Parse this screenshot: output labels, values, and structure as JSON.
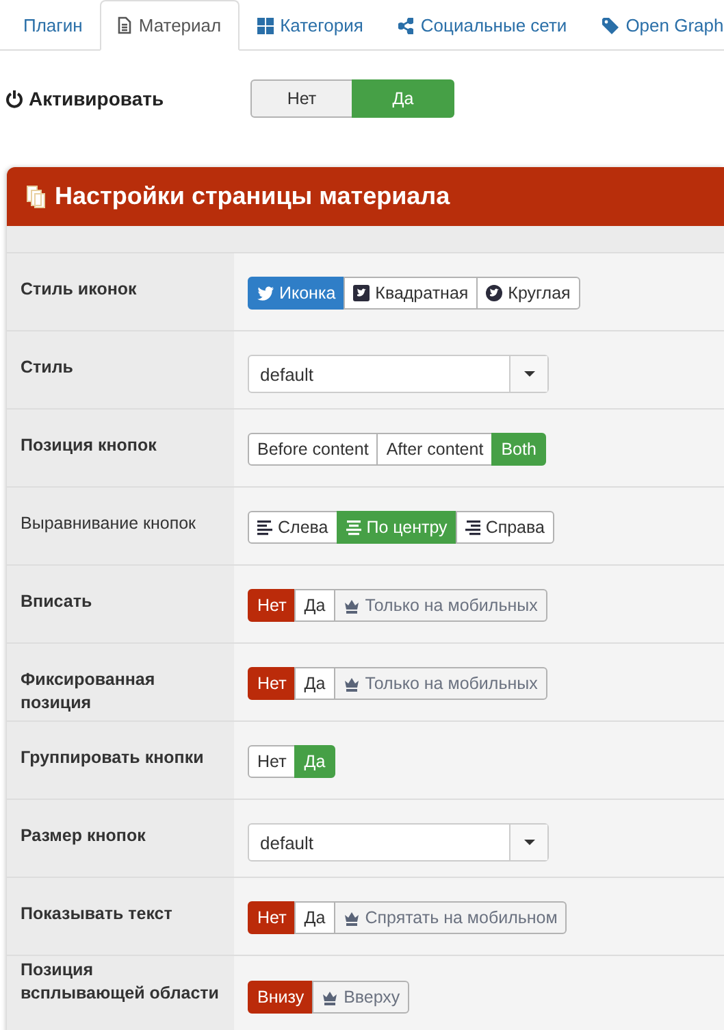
{
  "tabs": [
    {
      "label": "Плагин",
      "selected": false
    },
    {
      "label": "Материал",
      "selected": true
    },
    {
      "label": "Категория",
      "selected": false
    },
    {
      "label": "Социальные сети",
      "selected": false
    },
    {
      "label": "Open Graph",
      "selected": false
    }
  ],
  "activate": {
    "label": "Активировать",
    "options": [
      {
        "label": "Нет",
        "selected": false
      },
      {
        "label": "Да",
        "selected": true,
        "color": "#46a046"
      }
    ]
  },
  "panel": {
    "title": "Настройки страницы материала",
    "rows": [
      {
        "label": "Стиль иконок",
        "bold": true,
        "kind": "buttons",
        "options": [
          {
            "label": "Иконка",
            "selected": true,
            "color": "#2f7ec7",
            "kind": "plain"
          },
          {
            "label": "Квадратная",
            "selected": false,
            "kind": "plain"
          },
          {
            "label": "Круглая",
            "selected": false,
            "kind": "plain"
          }
        ]
      },
      {
        "label": "Стиль",
        "bold": true,
        "kind": "select",
        "value": "default"
      },
      {
        "label": "Позиция кнопок",
        "bold": true,
        "kind": "buttons",
        "options": [
          {
            "label": "Before content",
            "selected": false,
            "kind": "plain"
          },
          {
            "label": "After content",
            "selected": false,
            "kind": "plain"
          },
          {
            "label": "Both",
            "selected": true,
            "color": "#46a046",
            "kind": "plain"
          }
        ]
      },
      {
        "label": "Выравнивание кнопок",
        "bold": false,
        "kind": "buttons",
        "options": [
          {
            "label": "Слева",
            "selected": false,
            "kind": "plain"
          },
          {
            "label": "По центру",
            "selected": true,
            "color": "#46a046",
            "kind": "plain"
          },
          {
            "label": "Справа",
            "selected": false,
            "kind": "plain"
          }
        ]
      },
      {
        "label": "Вписать",
        "bold": true,
        "kind": "buttons",
        "options": [
          {
            "label": "Нет",
            "selected": true,
            "color": "#bb2b0a",
            "kind": "plain"
          },
          {
            "label": "Да",
            "selected": false,
            "kind": "plain"
          },
          {
            "label": "Только на мобильных",
            "selected": false,
            "kind": "mobile"
          }
        ]
      },
      {
        "label": "Фиксированная позиция",
        "bold": true,
        "kind": "buttons",
        "options": [
          {
            "label": "Нет",
            "selected": true,
            "color": "#bb2b0a",
            "kind": "plain"
          },
          {
            "label": "Да",
            "selected": false,
            "kind": "plain"
          },
          {
            "label": "Только на мобильных",
            "selected": false,
            "kind": "mobile"
          }
        ]
      },
      {
        "label": "Группировать кнопки",
        "bold": true,
        "kind": "buttons",
        "options": [
          {
            "label": "Нет",
            "selected": false,
            "kind": "plain"
          },
          {
            "label": "Да",
            "selected": true,
            "color": "#46a046",
            "kind": "plain"
          }
        ]
      },
      {
        "label": "Размер кнопок",
        "bold": true,
        "kind": "select",
        "value": "default"
      },
      {
        "label": "Показывать текст",
        "bold": true,
        "kind": "buttons",
        "options": [
          {
            "label": "Нет",
            "selected": true,
            "color": "#bb2b0a",
            "kind": "plain"
          },
          {
            "label": "Да",
            "selected": false,
            "kind": "plain"
          },
          {
            "label": "Спрятать на мобильном",
            "selected": false,
            "kind": "mobile"
          }
        ]
      },
      {
        "label": "Позиция всплывающей области",
        "bold": true,
        "kind": "buttons",
        "options": [
          {
            "label": "Внизу",
            "selected": true,
            "color": "#bb2b0a",
            "kind": "plain"
          },
          {
            "label": "Вверху",
            "selected": false,
            "kind": "mobile"
          }
        ]
      }
    ]
  }
}
